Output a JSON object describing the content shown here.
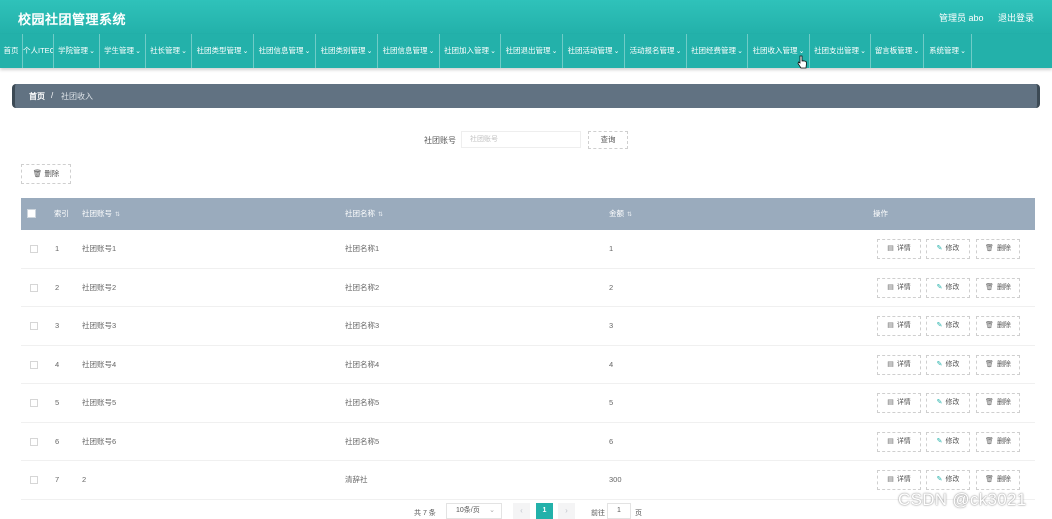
{
  "app": {
    "title": "校园社团管理系统"
  },
  "header": {
    "user": "管理员 abo",
    "logout": "退出登录"
  },
  "nav": {
    "chevron": "⌄",
    "items": [
      {
        "label": "首页",
        "dropdown": false
      },
      {
        "label": "个人ITEO",
        "dropdown": true
      },
      {
        "label": "学院管理",
        "dropdown": true
      },
      {
        "label": "学生管理",
        "dropdown": true
      },
      {
        "label": "社长管理",
        "dropdown": true
      },
      {
        "label": "社团类型管理",
        "dropdown": true
      },
      {
        "label": "社团信息管理",
        "dropdown": true
      },
      {
        "label": "社团类别管理",
        "dropdown": true
      },
      {
        "label": "社团信息管理",
        "dropdown": true
      },
      {
        "label": "社团加入管理",
        "dropdown": true
      },
      {
        "label": "社团退出管理",
        "dropdown": true
      },
      {
        "label": "社团活动管理",
        "dropdown": true
      },
      {
        "label": "活动报名管理",
        "dropdown": true
      },
      {
        "label": "社团经费管理",
        "dropdown": true
      },
      {
        "label": "社团收入管理",
        "dropdown": true
      },
      {
        "label": "社团支出管理",
        "dropdown": true
      },
      {
        "label": "留言板管理",
        "dropdown": true
      },
      {
        "label": "系统管理",
        "dropdown": true
      }
    ]
  },
  "breadcrumb": {
    "home": "首页",
    "separator": "/",
    "current": "社团收入"
  },
  "search": {
    "label": "社团账号",
    "placeholder": "社团账号",
    "button": "查询"
  },
  "toolbar": {
    "delete_label": "删除",
    "delete_icon": "trash-icon"
  },
  "table": {
    "columns": {
      "index": "索引",
      "account": "社团账号",
      "name": "社团名称",
      "amount": "金额",
      "actions": "操作"
    },
    "rows": [
      {
        "index": "1",
        "account": "社团账号1",
        "name": "社团名称1",
        "amount": "1"
      },
      {
        "index": "2",
        "account": "社团账号2",
        "name": "社团名称2",
        "amount": "2"
      },
      {
        "index": "3",
        "account": "社团账号3",
        "name": "社团名称3",
        "amount": "3"
      },
      {
        "index": "4",
        "account": "社团账号4",
        "name": "社团名称4",
        "amount": "4"
      },
      {
        "index": "5",
        "account": "社团账号5",
        "name": "社团名称5",
        "amount": "5"
      },
      {
        "index": "6",
        "account": "社团账号6",
        "name": "社团名称5",
        "amount": "6"
      },
      {
        "index": "7",
        "account": "2",
        "name": "清辞社",
        "amount": "300"
      }
    ],
    "action_labels": {
      "detail": "详情",
      "edit": "修改",
      "delete": "删除"
    }
  },
  "pagination": {
    "total": "共 7 条",
    "page_size": "10条/页",
    "current": "1",
    "goto_label": "前往",
    "goto_value": "1",
    "page_suffix": "页"
  },
  "watermark": "CSDN @ck3021",
  "colors": {
    "primary": "#23b1aa",
    "breadcrumb_bg": "#617282",
    "table_header": "#9aabbd"
  }
}
